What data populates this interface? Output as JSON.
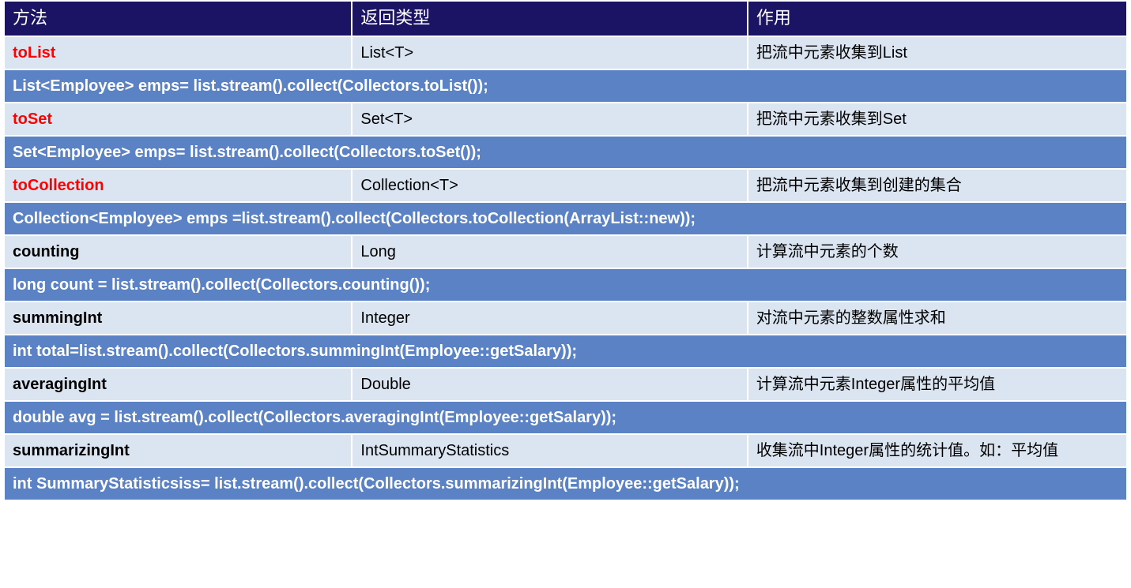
{
  "headers": {
    "method": "方法",
    "returnType": "返回类型",
    "description": "作用"
  },
  "rows": [
    {
      "type": "data",
      "methodStyle": "red",
      "method": "toList",
      "returnType": "List<T>",
      "description": "把流中元素收集到List"
    },
    {
      "type": "code",
      "code": "List<Employee> emps= list.stream().collect(Collectors.toList());"
    },
    {
      "type": "data",
      "methodStyle": "red",
      "method": "toSet",
      "returnType": "Set<T>",
      "description": "把流中元素收集到Set"
    },
    {
      "type": "code",
      "code": "Set<Employee> emps= list.stream().collect(Collectors.toSet());"
    },
    {
      "type": "data",
      "methodStyle": "red",
      "method": "toCollection",
      "returnType": "Collection<T>",
      "description": "把流中元素收集到创建的集合"
    },
    {
      "type": "code",
      "code": "Collection<Employee> emps =list.stream().collect(Collectors.toCollection(ArrayList::new));"
    },
    {
      "type": "data",
      "methodStyle": "black",
      "method": "counting",
      "returnType": "Long",
      "description": "计算流中元素的个数"
    },
    {
      "type": "code",
      "code": "long count = list.stream().collect(Collectors.counting());"
    },
    {
      "type": "data",
      "methodStyle": "black",
      "method": "summingInt",
      "returnType": "Integer",
      "description": "对流中元素的整数属性求和"
    },
    {
      "type": "code",
      "code": "int total=list.stream().collect(Collectors.summingInt(Employee::getSalary));"
    },
    {
      "type": "data",
      "methodStyle": "black",
      "method": "averagingInt",
      "returnType": "Double",
      "description": "计算流中元素Integer属性的平均值"
    },
    {
      "type": "code",
      "code": "double avg = list.stream().collect(Collectors.averagingInt(Employee::getSalary));"
    },
    {
      "type": "data",
      "methodStyle": "black",
      "method": "summarizingInt",
      "returnType": "IntSummaryStatistics",
      "description": "收集流中Integer属性的统计值。如：平均值"
    },
    {
      "type": "code",
      "code": "int SummaryStatisticsiss= list.stream().collect(Collectors.summarizingInt(Employee::getSalary));"
    }
  ]
}
